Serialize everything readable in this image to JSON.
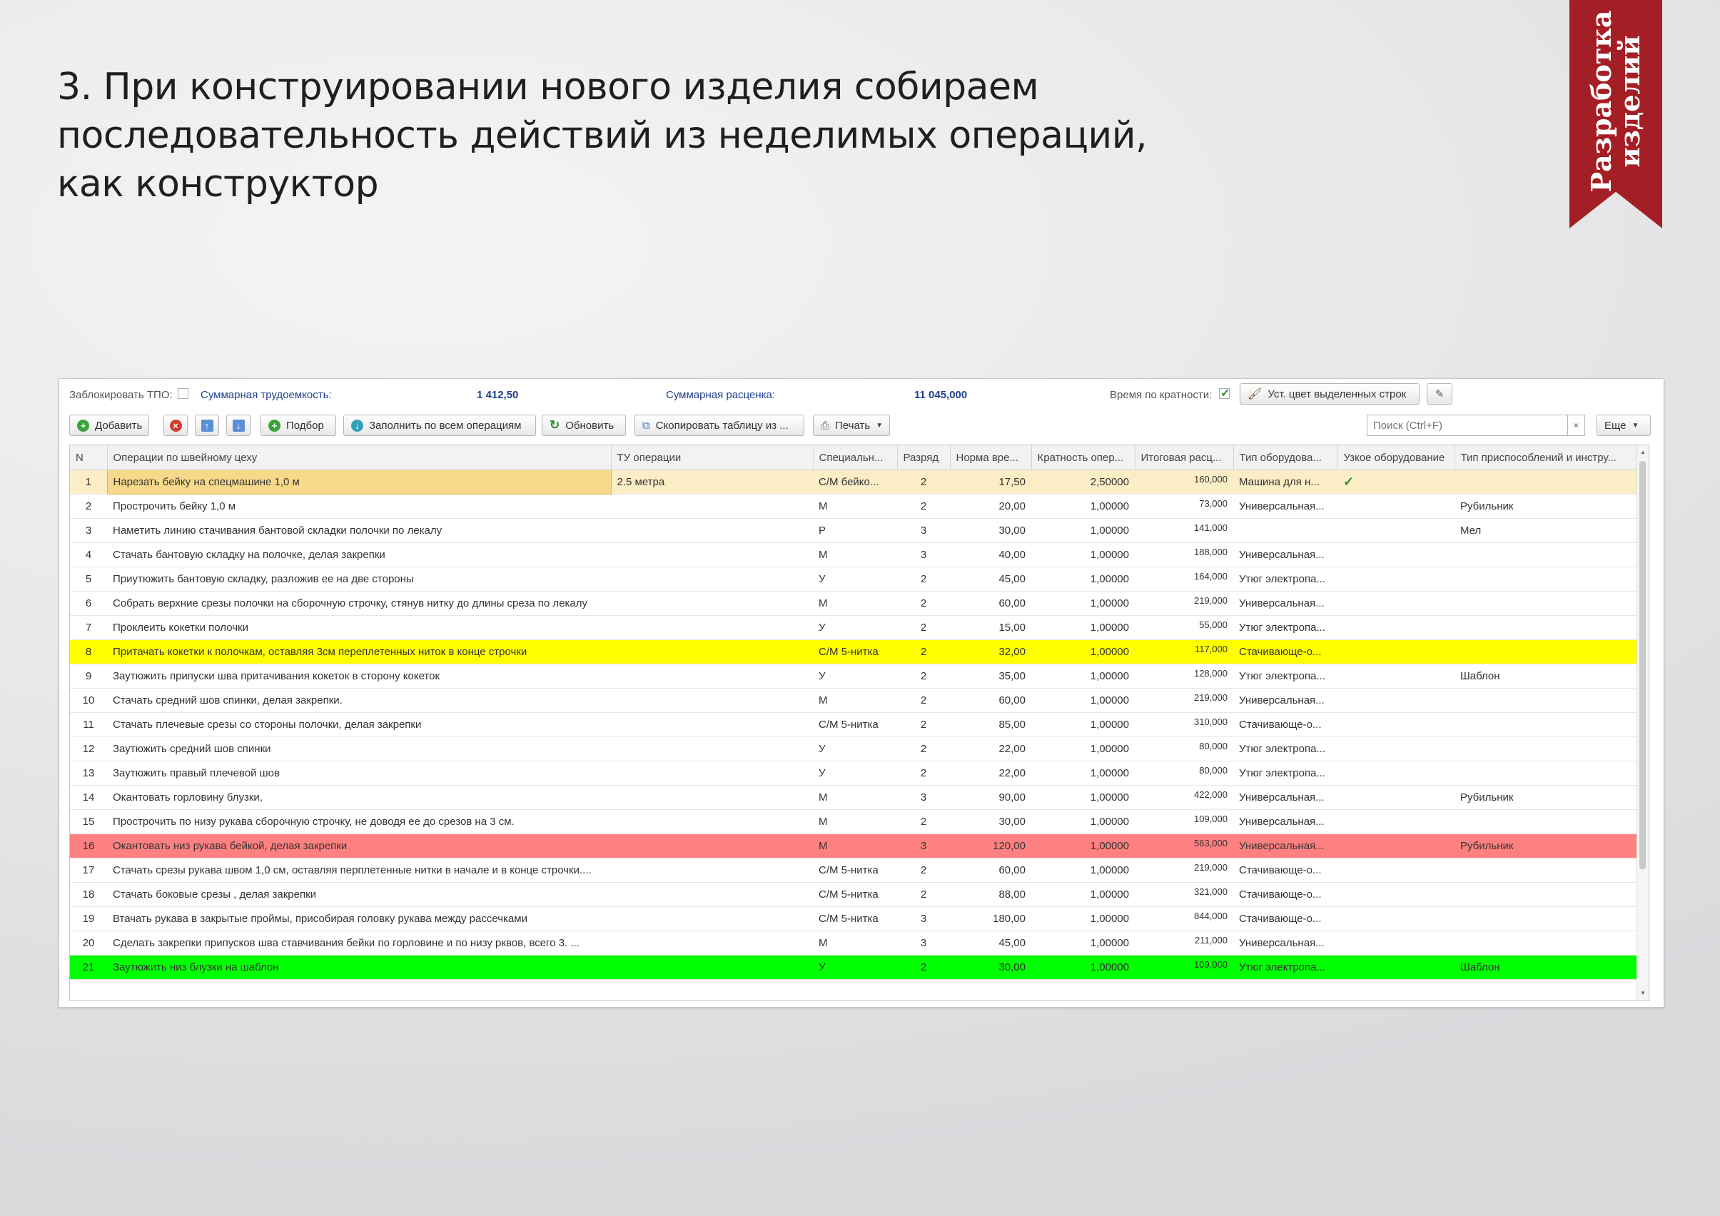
{
  "slide": {
    "title_lines": [
      "3. При конструировании нового изделия  собираем",
      "последовательность действий из неделимых операций,",
      "как конструктор"
    ],
    "ribbon_lines": [
      "Разработка",
      "изделий"
    ]
  },
  "summary": {
    "lock_label": "Заблокировать ТПО:",
    "lock_checked": false,
    "labor_label": "Суммарная трудоемкость:",
    "labor_value": "1 412,50",
    "rate_label": "Суммарная расценка:",
    "rate_value": "11 045,000",
    "multiplicity_label": "Время по кратности:",
    "multiplicity_checked": true,
    "color_button": "Уст. цвет выделенных строк"
  },
  "toolbar": {
    "add": "Добавить",
    "select": "Подбор",
    "fill_all": "Заполнить по всем операциям",
    "refresh": "Обновить",
    "copy_table": "Скопировать таблицу из ...",
    "print": "Печать",
    "search_placeholder": "Поиск (Ctrl+F)",
    "clear": "×",
    "more": "Еще"
  },
  "table": {
    "columns": [
      "N",
      "Операции по швейному цеху",
      "ТУ операции",
      "Специальн...",
      "Разряд",
      "Норма вре...",
      "Кратность опер...",
      "Итоговая расц...",
      "Тип оборудова...",
      "Узкое оборудование",
      "Тип приспособлений и инстру..."
    ],
    "rows": [
      {
        "n": "1",
        "op": "Нарезать бейку на спецмашине 1,0 м",
        "tu": "2.5 метра",
        "spec": "С/М бейко...",
        "grade": "2",
        "norm": "17,50",
        "mult": "2,50000",
        "price": "160,000",
        "equip": "Машина для н...",
        "narrow": true,
        "tool": "",
        "style": "sel"
      },
      {
        "n": "2",
        "op": "Прострочить бейку 1,0 м",
        "tu": "",
        "spec": "М",
        "grade": "2",
        "norm": "20,00",
        "mult": "1,00000",
        "price": "73,000",
        "equip": "Универсальная...",
        "narrow": false,
        "tool": "Рубильник",
        "style": ""
      },
      {
        "n": "3",
        "op": "Наметить линию стачивания бантовой складки полочки по лекалу",
        "tu": "",
        "spec": "Р",
        "grade": "3",
        "norm": "30,00",
        "mult": "1,00000",
        "price": "141,000",
        "equip": "",
        "narrow": false,
        "tool": "Мел",
        "style": ""
      },
      {
        "n": "4",
        "op": "Стачать бантовую складку на полочке, делая закрепки",
        "tu": "",
        "spec": "М",
        "grade": "3",
        "norm": "40,00",
        "mult": "1,00000",
        "price": "188,000",
        "equip": "Универсальная...",
        "narrow": false,
        "tool": "",
        "style": ""
      },
      {
        "n": "5",
        "op": "Приутюжить бантовую складку, разложив ее на две стороны",
        "tu": "",
        "spec": "У",
        "grade": "2",
        "norm": "45,00",
        "mult": "1,00000",
        "price": "164,000",
        "equip": "Утюг электропа...",
        "narrow": false,
        "tool": "",
        "style": ""
      },
      {
        "n": "6",
        "op": "Собрать верхние срезы полочки на сборочную строчку, стянув  нитку до длины среза по лекалу",
        "tu": "",
        "spec": "М",
        "grade": "2",
        "norm": "60,00",
        "mult": "1,00000",
        "price": "219,000",
        "equip": "Универсальная...",
        "narrow": false,
        "tool": "",
        "style": ""
      },
      {
        "n": "7",
        "op": "Проклеить кокетки полочки",
        "tu": "",
        "spec": "У",
        "grade": "2",
        "norm": "15,00",
        "mult": "1,00000",
        "price": "55,000",
        "equip": "Утюг электропа...",
        "narrow": false,
        "tool": "",
        "style": ""
      },
      {
        "n": "8",
        "op": "Притачать кокетки к полочкам, оставляя 3см переплетенных ниток в конце строчки",
        "tu": "",
        "spec": "С/М 5-нитка",
        "grade": "2",
        "norm": "32,00",
        "mult": "1,00000",
        "price": "117,000",
        "equip": "Стачивающе-о...",
        "narrow": false,
        "tool": "",
        "style": "yel"
      },
      {
        "n": "9",
        "op": "Заутюжить припуски  шва притачивания кокеток в сторону кокеток",
        "tu": "",
        "spec": "У",
        "grade": "2",
        "norm": "35,00",
        "mult": "1,00000",
        "price": "128,000",
        "equip": "Утюг электропа...",
        "narrow": false,
        "tool": "Шаблон",
        "style": ""
      },
      {
        "n": "10",
        "op": "Стачать средний шов спинки, делая закрепки.",
        "tu": "",
        "spec": "М",
        "grade": "2",
        "norm": "60,00",
        "mult": "1,00000",
        "price": "219,000",
        "equip": "Универсальная...",
        "narrow": false,
        "tool": "",
        "style": ""
      },
      {
        "n": "11",
        "op": "Стачать плечевые срезы  со стороны полочки, делая закрепки",
        "tu": "",
        "spec": "С/М 5-нитка",
        "grade": "2",
        "norm": "85,00",
        "mult": "1,00000",
        "price": "310,000",
        "equip": "Стачивающе-о...",
        "narrow": false,
        "tool": "",
        "style": ""
      },
      {
        "n": "12",
        "op": "Заутюжить средний шов спинки",
        "tu": "",
        "spec": "У",
        "grade": "2",
        "norm": "22,00",
        "mult": "1,00000",
        "price": "80,000",
        "equip": "Утюг электропа...",
        "narrow": false,
        "tool": "",
        "style": ""
      },
      {
        "n": "13",
        "op": "Заутюжить правый плечевой шов",
        "tu": "",
        "spec": "У",
        "grade": "2",
        "norm": "22,00",
        "mult": "1,00000",
        "price": "80,000",
        "equip": "Утюг электропа...",
        "narrow": false,
        "tool": "",
        "style": ""
      },
      {
        "n": "14",
        "op": "Окантовать горловину блузки,",
        "tu": "",
        "spec": "М",
        "grade": "3",
        "norm": "90,00",
        "mult": "1,00000",
        "price": "422,000",
        "equip": "Универсальная...",
        "narrow": false,
        "tool": "Рубильник",
        "style": ""
      },
      {
        "n": "15",
        "op": "Прострочить по низу рукава сборочную строчку, не доводя ее до срезов на 3 см.",
        "tu": "",
        "spec": "М",
        "grade": "2",
        "norm": "30,00",
        "mult": "1,00000",
        "price": "109,000",
        "equip": "Универсальная...",
        "narrow": false,
        "tool": "",
        "style": ""
      },
      {
        "n": "16",
        "op": "Окантовать низ рукава бейкой, делая закрепки",
        "tu": "",
        "spec": "М",
        "grade": "3",
        "norm": "120,00",
        "mult": "1,00000",
        "price": "563,000",
        "equip": "Универсальная...",
        "narrow": false,
        "tool": "Рубильник",
        "style": "red"
      },
      {
        "n": "17",
        "op": "Стачать срезы рукава швом 1,0 см, оставляя перплетенные нитки в начале и в конце строчки....",
        "tu": "",
        "spec": "С/М 5-нитка",
        "grade": "2",
        "norm": "60,00",
        "mult": "1,00000",
        "price": "219,000",
        "equip": "Стачивающе-о...",
        "narrow": false,
        "tool": "",
        "style": ""
      },
      {
        "n": "18",
        "op": "Стачать боковые срезы , делая закрепки",
        "tu": "",
        "spec": "С/М 5-нитка",
        "grade": "2",
        "norm": "88,00",
        "mult": "1,00000",
        "price": "321,000",
        "equip": "Стачивающе-о...",
        "narrow": false,
        "tool": "",
        "style": ""
      },
      {
        "n": "19",
        "op": "Втачать рукава  в закрытые  проймы, присобирая головку рукава между рассечками",
        "tu": "",
        "spec": "С/М 5-нитка",
        "grade": "3",
        "norm": "180,00",
        "mult": "1,00000",
        "price": "844,000",
        "equip": "Стачивающе-о...",
        "narrow": false,
        "tool": "",
        "style": ""
      },
      {
        "n": "20",
        "op": "Сделать закрепки припусков шва ставчивания бейки по горловине и по низу рквов, всего 3. ...",
        "tu": "",
        "spec": "М",
        "grade": "3",
        "norm": "45,00",
        "mult": "1,00000",
        "price": "211,000",
        "equip": "Универсальная...",
        "narrow": false,
        "tool": "",
        "style": ""
      },
      {
        "n": "21",
        "op": "Заутюжить низ блузки на шаблон",
        "tu": "",
        "spec": "У",
        "grade": "2",
        "norm": "30,00",
        "mult": "1,00000",
        "price": "109,000",
        "equip": "Утюг электропа...",
        "narrow": false,
        "tool": "Шаблон",
        "style": "grn"
      }
    ]
  }
}
